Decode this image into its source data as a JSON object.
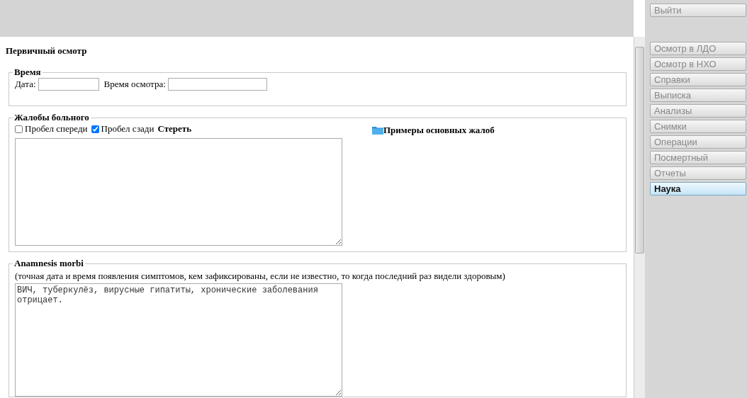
{
  "page_title": "Первичный осмотр",
  "time_section": {
    "legend": "Время",
    "date_label": "Дата:",
    "time_label": "Время осмотра:"
  },
  "complaints_section": {
    "legend": "Жалобы больного",
    "options": [
      {
        "label": "Пробел спереди",
        "checked": false
      },
      {
        "label": "Пробел сзади",
        "checked": true
      }
    ],
    "clear_link": "Стереть",
    "examples_link": "Примеры основных жалоб"
  },
  "anamnesis_section": {
    "legend": "Anamnesis morbi",
    "hint": "(точная дата и время появления симптомов, кем зафиксированы, если не известно, то когда последний раз видели здоровым)",
    "value": "ВИЧ, туберкулёз, вирусные гипатиты, хронические заболевания отрицает."
  },
  "logout_button": "Выйти",
  "nav_buttons": [
    {
      "label": "Осмотр в ЛДО",
      "selected": false
    },
    {
      "label": "Осмотр в НХО",
      "selected": false
    },
    {
      "label": "Справки",
      "selected": false
    },
    {
      "label": "Выписка",
      "selected": false
    },
    {
      "label": "Анализы",
      "selected": false
    },
    {
      "label": "Снимки",
      "selected": false
    },
    {
      "label": "Операции",
      "selected": false
    },
    {
      "label": "Посмертный",
      "selected": false
    },
    {
      "label": "Отчеты",
      "selected": false
    },
    {
      "label": "Наука",
      "selected": true
    }
  ]
}
